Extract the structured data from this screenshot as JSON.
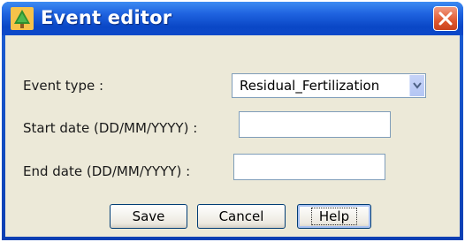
{
  "window": {
    "title": "Event editor",
    "app_icon": "tree-icon",
    "close_icon": "close-icon"
  },
  "form": {
    "event_type_label": "Event type :",
    "event_type_value": "Residual_Fertilization",
    "start_date_label": "Start date (DD/MM/YYYY) :",
    "start_date_value": "",
    "end_date_label": "End date (DD/MM/YYYY) :",
    "end_date_value": ""
  },
  "buttons": {
    "save": "Save",
    "cancel": "Cancel",
    "help": "Help"
  },
  "colors": {
    "titlebar": "#1f63e0",
    "close": "#e0582f",
    "panel": "#ece9d8"
  }
}
